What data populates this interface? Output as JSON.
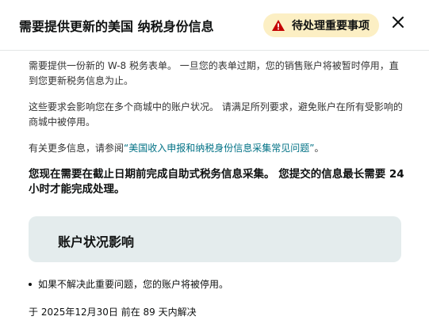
{
  "header": {
    "title": "需要提供更新的美国 纳税身份信息",
    "badge_label": "待处理重要事项",
    "badge_icon": "warning-triangle-icon",
    "close_icon": "close-icon"
  },
  "content": {
    "para1": "需要提供一份新的 W-8 税务表单。 一旦您的表单过期，您的销售账户将被暂时停用，直到您更新税务信息为止。",
    "para2": "这些要求会影响您在多个商城中的账户状况。 请满足所列要求，避免账户在所有受影响的商城中被停用。",
    "para3_prefix": "有关更多信息，请参阅",
    "para3_link": "“美国收入申报和纳税身份信息采集常见问题”",
    "para3_suffix": "。",
    "notice": "您现在需要在截止日期前完成自助式税务信息采集。 您提交的信息最长需要 24 小时才能完成处理。"
  },
  "impact": {
    "title": "账户状况影响",
    "bullet": "如果不解决此重要问题，您的账户将被停用。"
  },
  "resolve": "于 2025年12月30日 前在 89 天内解决",
  "colors": {
    "badge_bg": "#fcefc4",
    "warning_red": "#c40000",
    "link": "#007185",
    "impact_bg": "#e4eced"
  }
}
